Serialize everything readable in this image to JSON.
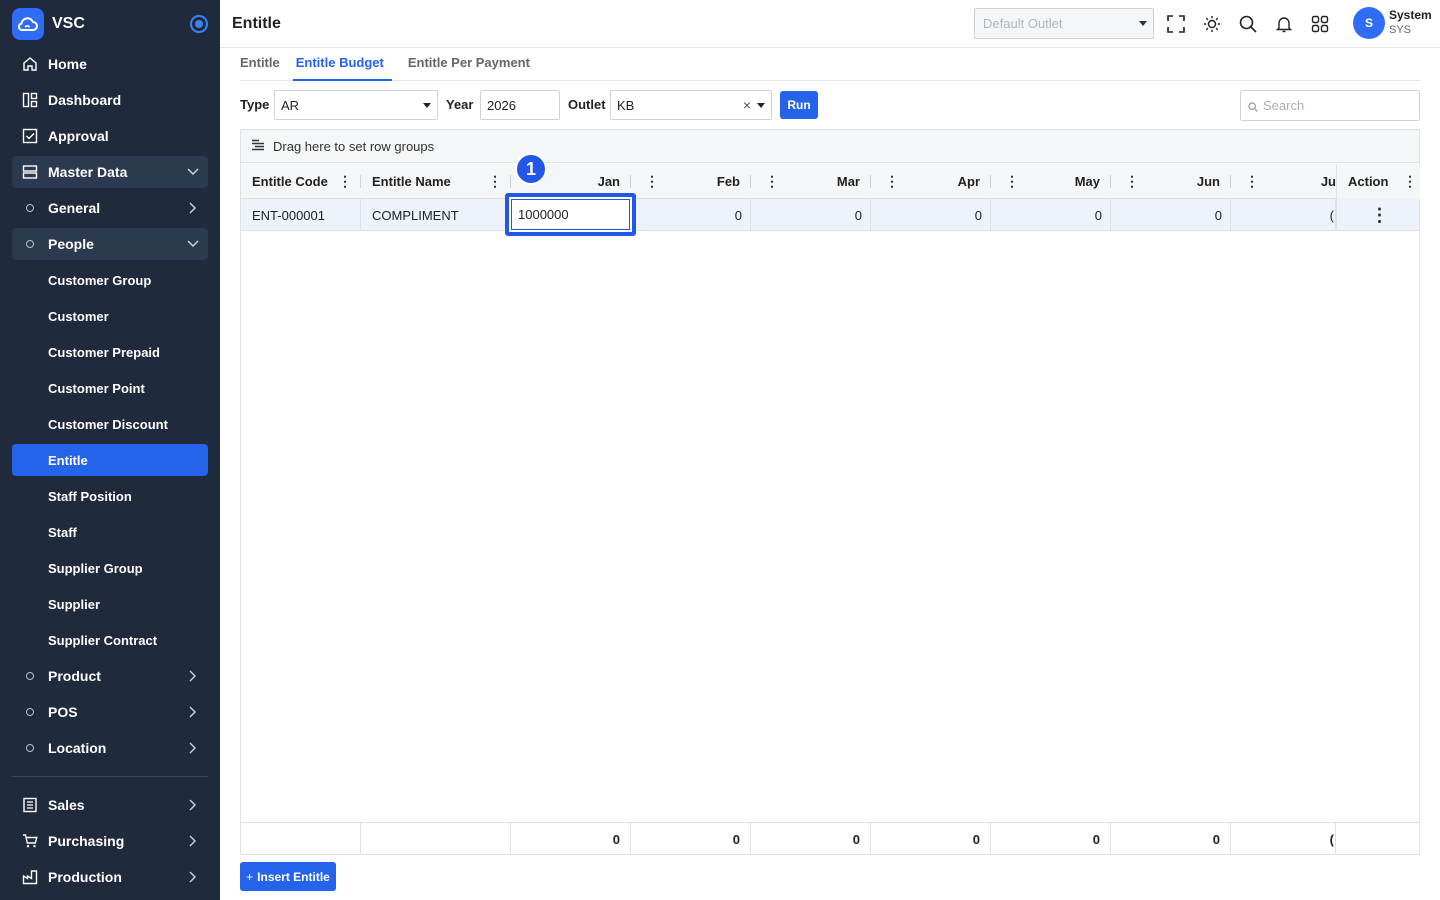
{
  "app": {
    "name": "VSC"
  },
  "sidebar": {
    "top": [
      {
        "label": "Home",
        "icon": "home-icon"
      },
      {
        "label": "Dashboard",
        "icon": "dashboard-icon"
      },
      {
        "label": "Approval",
        "icon": "approval-icon"
      }
    ],
    "master_data": {
      "label": "Master Data"
    },
    "general": {
      "label": "General"
    },
    "people": {
      "label": "People"
    },
    "people_items": [
      "Customer Group",
      "Customer",
      "Customer Prepaid",
      "Customer Point",
      "Customer Discount",
      "Entitle",
      "Staff Position",
      "Staff",
      "Supplier Group",
      "Supplier",
      "Supplier Contract"
    ],
    "product": {
      "label": "Product"
    },
    "pos": {
      "label": "POS"
    },
    "location": {
      "label": "Location"
    },
    "bottom": [
      {
        "label": "Sales",
        "icon": "sales-icon"
      },
      {
        "label": "Purchasing",
        "icon": "cart-icon"
      },
      {
        "label": "Production",
        "icon": "production-icon"
      }
    ]
  },
  "header": {
    "title": "Entitle",
    "outlet_placeholder": "Default Outlet",
    "user": {
      "initial": "S",
      "name": "System",
      "code": "SYS"
    }
  },
  "tabs": [
    {
      "label": "Entitle",
      "active": false
    },
    {
      "label": "Entitle Budget",
      "active": true
    },
    {
      "label": "Entitle Per Payment",
      "active": false
    }
  ],
  "filters": {
    "type_label": "Type",
    "type_value": "AR",
    "year_label": "Year",
    "year_value": "2026",
    "outlet_label": "Outlet",
    "outlet_value": "KB",
    "run_label": "Run",
    "search_placeholder": "Search"
  },
  "grid": {
    "group_panel_text": "Drag here to set row groups",
    "columns": [
      "Entitle Code",
      "Entitle Name",
      "Jan",
      "Feb",
      "Mar",
      "Apr",
      "May",
      "Jun",
      "Ju",
      "Action"
    ],
    "row": {
      "code": "ENT-000001",
      "name": "COMPLIMENT",
      "jan_edit": "1000000",
      "months": [
        "0",
        "0",
        "0",
        "0",
        "0",
        "("
      ]
    },
    "footer": [
      "0",
      "0",
      "0",
      "0",
      "0",
      "0",
      "("
    ]
  },
  "annotation": {
    "badge": "1"
  },
  "actions": {
    "insert_label": "Insert Entitle",
    "insert_prefix": "+"
  }
}
